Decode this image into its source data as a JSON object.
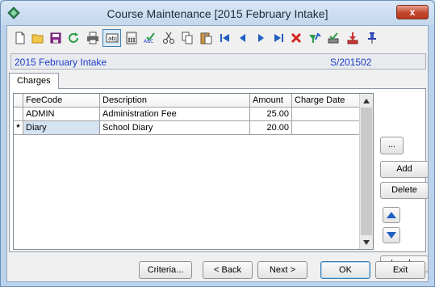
{
  "window": {
    "title": "Course Maintenance  [2015 February Intake]",
    "close_label": "x"
  },
  "toolbar": {
    "icons": [
      "new-icon",
      "open-icon",
      "save-icon",
      "refresh-icon",
      "print-icon",
      "edit-field-icon",
      "calculator-icon",
      "spellcheck-icon",
      "cut-icon",
      "copy-icon",
      "paste-icon",
      "first-record-icon",
      "previous-record-icon",
      "next-record-icon",
      "last-record-icon",
      "delete-icon",
      "filter-icon",
      "approve-icon",
      "download-icon",
      "pin-icon"
    ],
    "spellcheck_text": "ABC"
  },
  "header": {
    "intake_name": "2015 February Intake",
    "intake_code": "S/201502"
  },
  "tabs": [
    {
      "label": "Charges"
    }
  ],
  "grid": {
    "columns": [
      "FeeCode",
      "Description",
      "Amount",
      "Charge Date"
    ],
    "rows": [
      {
        "indicator": "",
        "feecode": "ADMIN",
        "description": "Administration Fee",
        "amount": "25.00",
        "charge_date": ""
      },
      {
        "indicator": "*",
        "feecode": "Diary",
        "description": "School Diary",
        "amount": "20.00",
        "charge_date": ""
      }
    ]
  },
  "side_buttons": {
    "ellipsis": "...",
    "add": "Add",
    "delete": "Delete",
    "load": "Load..."
  },
  "footer": {
    "criteria": "Criteria...",
    "back": "< Back",
    "next": "Next >",
    "ok": "OK",
    "exit": "Exit"
  },
  "colors": {
    "accent_blue": "#1a3cc8",
    "title_bar": "#c3d7ee",
    "close_red": "#c3472d"
  }
}
